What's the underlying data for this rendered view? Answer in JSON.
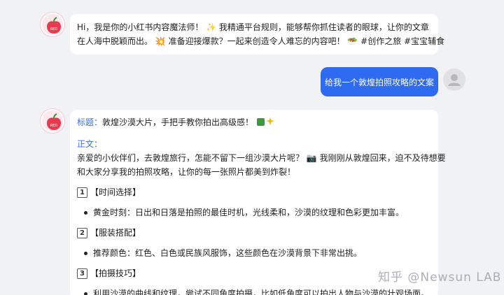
{
  "intro_message": {
    "line1": "Hi，我是你的小红书内容魔法师！ ✨ 我精通平台规则，能够帮你抓住读者的眼球，让你的文章",
    "line2": "在人海中脱颖而出。 💥 准备迎接爆款？一起来创造令人难忘的内容吧！ 🥗 #创作之旅 #宝宝辅食"
  },
  "user_message": {
    "text": "给我一个敦煌拍照攻略的文案"
  },
  "reply": {
    "title_label": "标题：",
    "title_text": "敦煌沙漠大片，手把手教你拍出高级感！",
    "body_label": "正文：",
    "body_line1": "亲爱的小伙伴们，去敦煌旅行，怎能不留下一组沙漠大片呢？ 📷 我刚刚从敦煌回来，迫不及待想要",
    "body_line2": "和大家分享我的拍照攻略，让你的每一张照片都美到炸裂！",
    "sections": [
      {
        "num": "1",
        "heading": "【时间选择】",
        "bullet": "黄金时刻：日出和日落是拍照的最佳时机，光线柔和，沙漠的纹理和色彩更加丰富。"
      },
      {
        "num": "2",
        "heading": "【服装搭配】",
        "bullet": "推荐颜色：红色、白色或民族风服饰，这些颜色在沙漠背景下非常出挑。"
      },
      {
        "num": "3",
        "heading": "【拍摄技巧】",
        "bullet": "利用沙漠的曲线和纹理，尝试不同角度拍摄，比如低角度可以拍出人物与沙漠的壮观场面。"
      }
    ]
  },
  "avatar_badge": "RED",
  "watermark": "知乎 @Newsun LAB",
  "colors": {
    "accent": "#2f6bf0",
    "avatar_red": "#e8394f",
    "label_blue": "#3d6de8"
  }
}
